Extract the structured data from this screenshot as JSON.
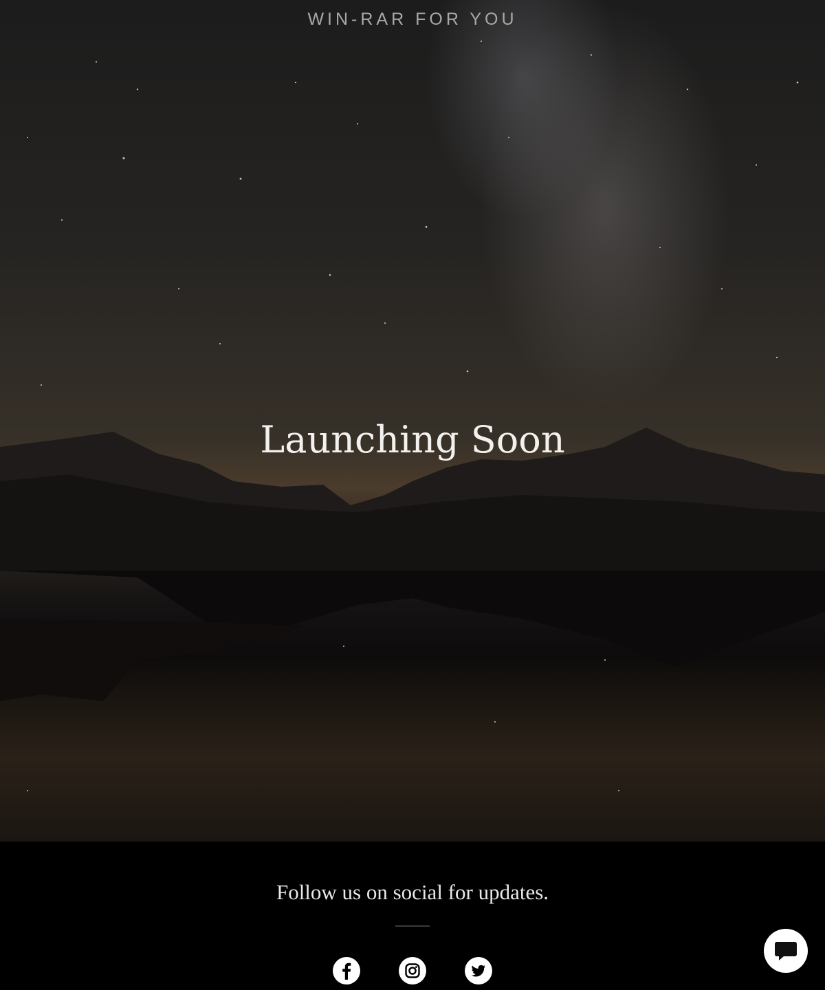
{
  "site_title": "WIN-RAR FOR YOU",
  "hero": {
    "headline": "Launching Soon"
  },
  "footer": {
    "follow_text": "Follow us on social for updates.",
    "social_links": [
      {
        "name": "facebook-icon"
      },
      {
        "name": "instagram-icon"
      },
      {
        "name": "twitter-icon"
      }
    ]
  },
  "chat_widget": {
    "icon": "chat-bubble-icon"
  },
  "colors": {
    "background": "#000000",
    "text": "#f3f1ee",
    "title": "#a8a8a8"
  }
}
